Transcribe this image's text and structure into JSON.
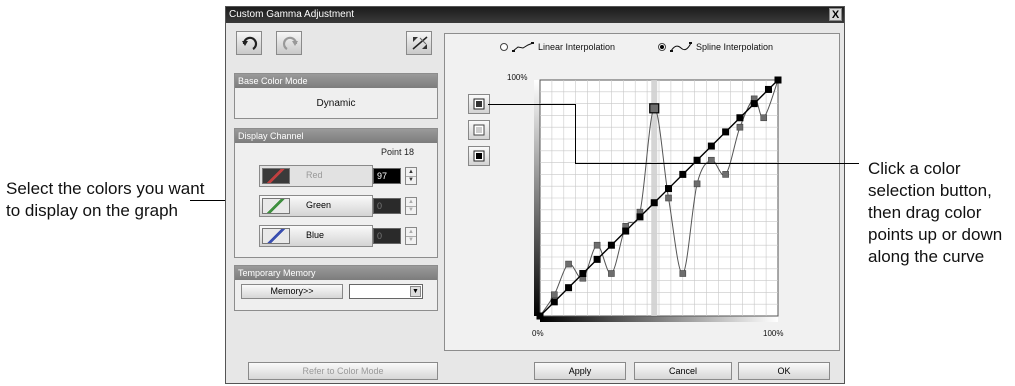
{
  "callouts": {
    "left": "Select the colors you want to display on the graph",
    "right": "Click a color selection button, then drag color points up or down along the curve"
  },
  "window": {
    "title": "Custom Gamma Adjustment",
    "close_label": "X"
  },
  "toolbar": {
    "undo_icon": "undo-icon",
    "redo_icon": "redo-icon",
    "reset_icon": "reset-diagonal-icon"
  },
  "base_color_mode": {
    "header": "Base Color Mode",
    "value": "Dynamic"
  },
  "display_channel": {
    "header": "Display Channel",
    "point_label": "Point",
    "point_value": "18",
    "channels": [
      {
        "label": "Red",
        "value": "97",
        "state": "disabled",
        "swatch": "#c04040"
      },
      {
        "label": "Green",
        "value": "0",
        "state": "enabled",
        "swatch": "#3f8f3f"
      },
      {
        "label": "Blue",
        "value": "0",
        "state": "enabled",
        "swatch": "#3a4fb0"
      }
    ]
  },
  "temporary_memory": {
    "header": "Temporary Memory",
    "button_label": "Memory>>",
    "select_value": ""
  },
  "interpolation": {
    "linear_label": "Linear Interpolation",
    "spline_label": "Spline Interpolation",
    "selected": "spline"
  },
  "graph": {
    "y_max_label": "100%",
    "x_min_label": "0%",
    "x_max_label": "100%",
    "selected_point_index": 8,
    "grid": true
  },
  "chart_data": {
    "type": "line",
    "series": [
      {
        "name": "Red",
        "x": [
          0,
          6,
          12,
          18,
          24,
          30,
          36,
          42,
          48,
          54,
          60,
          66,
          72,
          78,
          84,
          90,
          94,
          100
        ],
        "values": [
          0,
          9,
          22,
          16,
          30,
          18,
          38,
          44,
          88,
          50,
          18,
          56,
          66,
          60,
          80,
          92,
          84,
          100
        ]
      },
      {
        "name": "Linear",
        "x": [
          0,
          6,
          12,
          18,
          24,
          30,
          36,
          42,
          48,
          54,
          60,
          66,
          72,
          78,
          84,
          90,
          96,
          100
        ],
        "values": [
          0,
          6,
          12,
          18,
          24,
          30,
          36,
          42,
          48,
          54,
          60,
          66,
          72,
          78,
          84,
          90,
          96,
          100
        ]
      }
    ],
    "xlim": [
      0,
      100
    ],
    "ylim": [
      0,
      100
    ],
    "x_tick_labels": [
      "0%",
      "100%"
    ],
    "y_tick_labels": [
      "100%"
    ]
  },
  "footer": {
    "refer_label": "Refer to Color Mode",
    "apply_label": "Apply",
    "cancel_label": "Cancel",
    "ok_label": "OK"
  }
}
